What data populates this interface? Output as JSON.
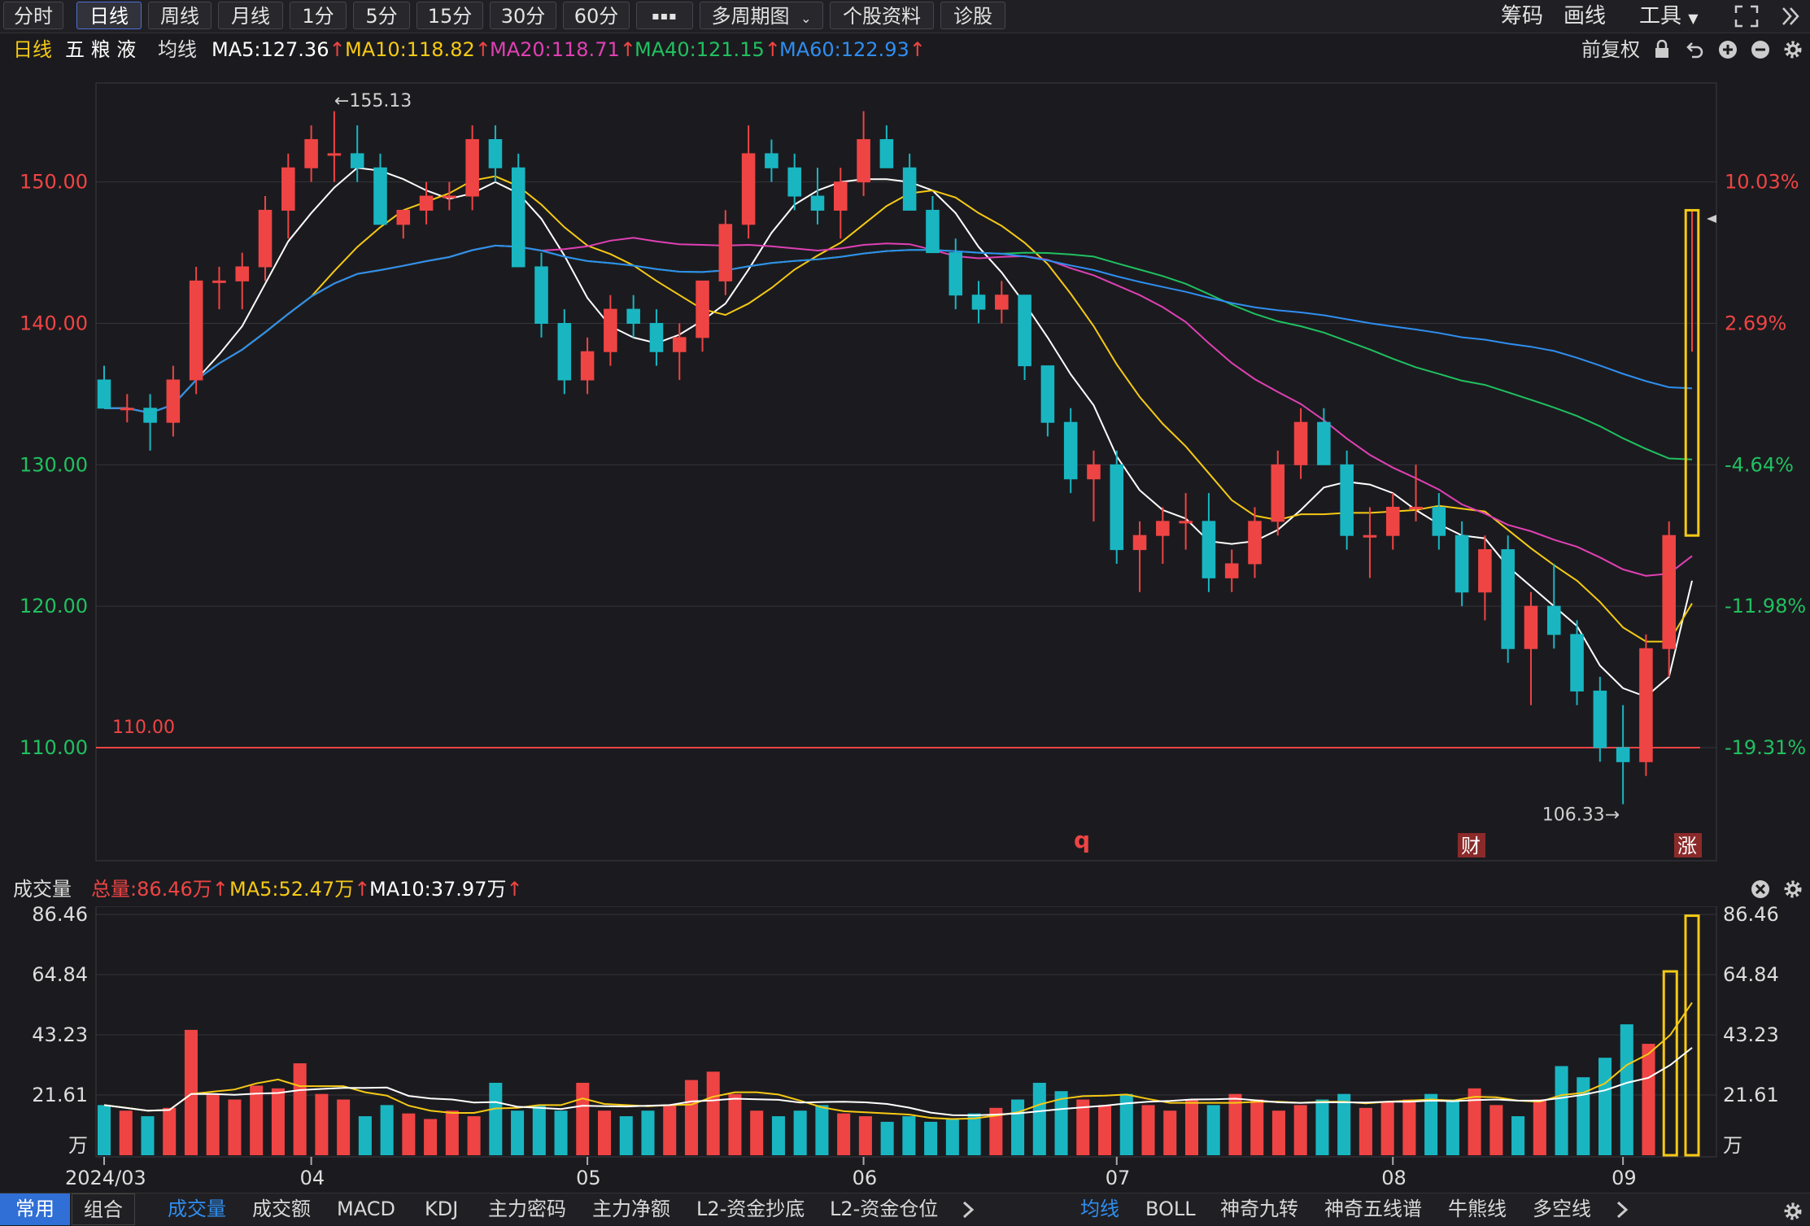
{
  "toolbar": {
    "tabs": [
      "分时",
      "日线",
      "周线",
      "月线",
      "1分",
      "5分",
      "15分",
      "30分",
      "60分"
    ],
    "more": "▪▪▪",
    "multi_period": "多周期图",
    "stock_info": "个股资料",
    "diagnose": "诊股",
    "chips": "筹码",
    "draw": "画线",
    "tools": "工具"
  },
  "info": {
    "period": "日线",
    "stock_name": "五 粮 液",
    "ma_label": "均线",
    "ma5": "MA5:127.36",
    "ma10": "MA10:118.82",
    "ma20": "MA20:118.71",
    "ma40": "MA40:121.15",
    "ma60": "MA60:122.93",
    "adjust": "前复权"
  },
  "colors": {
    "up": "#ef4444",
    "down": "#19b6c2",
    "ma5": "#ffffff",
    "ma10": "#f6c915",
    "ma20": "#e040b4",
    "ma40": "#20c060",
    "ma60": "#2f8ef0"
  },
  "chart_data": {
    "type": "candlestick",
    "y_range": [
      102,
      157
    ],
    "y_ticks": [
      "150.00",
      "140.00",
      "130.00",
      "120.00",
      "110.00"
    ],
    "y_tick_values": [
      150,
      140,
      130,
      120,
      110
    ],
    "pct_ticks": [
      "10.03%",
      "2.69%",
      "-4.64%",
      "-11.98%",
      "-19.31%"
    ],
    "high_label": "←155.13",
    "low_label": "106.33→",
    "hline_label": "110.00",
    "hline_value": 110,
    "markers": {
      "q": "q",
      "cai": "财",
      "zhang": "涨"
    },
    "x_labels": [
      "2024/03",
      "04",
      "05",
      "06",
      "07",
      "08",
      "09"
    ],
    "x_label_index": [
      0,
      9,
      21,
      33,
      44,
      56,
      66
    ],
    "ohlc": [
      [
        136,
        137,
        134,
        134
      ],
      [
        134,
        135,
        133,
        134
      ],
      [
        134,
        135,
        131,
        133
      ],
      [
        133,
        137,
        132,
        136
      ],
      [
        136,
        144,
        135,
        143
      ],
      [
        143,
        144,
        141,
        143
      ],
      [
        143,
        145,
        141,
        144
      ],
      [
        144,
        149,
        143,
        148
      ],
      [
        148,
        152,
        146,
        151
      ],
      [
        151,
        154,
        150,
        153
      ],
      [
        152,
        155,
        150,
        152
      ],
      [
        152,
        154,
        150,
        151
      ],
      [
        151,
        152,
        147,
        147
      ],
      [
        147,
        148,
        146,
        148
      ],
      [
        148,
        150,
        147,
        149
      ],
      [
        149,
        150,
        148,
        149
      ],
      [
        149,
        154,
        148,
        153
      ],
      [
        153,
        154,
        150,
        151
      ],
      [
        151,
        152,
        144,
        144
      ],
      [
        144,
        145,
        139,
        140
      ],
      [
        140,
        141,
        135,
        136
      ],
      [
        136,
        139,
        135,
        138
      ],
      [
        138,
        142,
        137,
        141
      ],
      [
        141,
        142,
        139,
        140
      ],
      [
        140,
        141,
        137,
        138
      ],
      [
        138,
        140,
        136,
        139
      ],
      [
        139,
        143,
        138,
        143
      ],
      [
        143,
        148,
        142,
        147
      ],
      [
        147,
        154,
        146,
        152
      ],
      [
        152,
        153,
        150,
        151
      ],
      [
        151,
        152,
        148,
        149
      ],
      [
        149,
        151,
        147,
        148
      ],
      [
        148,
        151,
        146,
        150
      ],
      [
        150,
        155,
        149,
        153
      ],
      [
        153,
        154,
        151,
        151
      ],
      [
        151,
        152,
        148,
        148
      ],
      [
        148,
        149,
        145,
        145
      ],
      [
        145,
        146,
        141,
        142
      ],
      [
        142,
        143,
        140,
        141
      ],
      [
        141,
        143,
        140,
        142
      ],
      [
        142,
        142,
        136,
        137
      ],
      [
        137,
        137,
        132,
        133
      ],
      [
        133,
        134,
        128,
        129
      ],
      [
        129,
        131,
        126,
        130
      ],
      [
        130,
        131,
        123,
        124
      ],
      [
        124,
        126,
        121,
        125
      ],
      [
        125,
        127,
        123,
        126
      ],
      [
        126,
        128,
        124,
        126
      ],
      [
        126,
        128,
        121,
        122
      ],
      [
        122,
        124,
        121,
        123
      ],
      [
        123,
        127,
        122,
        126
      ],
      [
        126,
        131,
        125,
        130
      ],
      [
        130,
        134,
        129,
        133
      ],
      [
        133,
        134,
        130,
        130
      ],
      [
        130,
        131,
        124,
        125
      ],
      [
        125,
        127,
        122,
        125
      ],
      [
        125,
        128,
        124,
        127
      ],
      [
        127,
        130,
        126,
        127
      ],
      [
        127,
        128,
        124,
        125
      ],
      [
        125,
        126,
        120,
        121
      ],
      [
        121,
        125,
        119,
        124
      ],
      [
        124,
        125,
        116,
        117
      ],
      [
        117,
        121,
        113,
        120
      ],
      [
        120,
        123,
        117,
        118
      ],
      [
        118,
        119,
        113,
        114
      ],
      [
        114,
        115,
        109,
        110
      ],
      [
        110,
        113,
        106,
        109
      ],
      [
        109,
        118,
        108,
        117
      ],
      [
        117,
        126,
        115,
        125
      ],
      [
        125,
        148,
        138,
        148
      ]
    ],
    "volume_max": 86.46,
    "volume_ticks": [
      "86.46",
      "64.84",
      "43.23",
      "21.61"
    ],
    "volume_tick_values": [
      86.46,
      64.84,
      43.23,
      21.61
    ],
    "volume_unit": "万",
    "volume": [
      18,
      16,
      14,
      17,
      45,
      22,
      20,
      25,
      24,
      33,
      22,
      20,
      14,
      18,
      15,
      13,
      16,
      14,
      26,
      16,
      18,
      16,
      26,
      16,
      14,
      16,
      18,
      27,
      30,
      22,
      16,
      14,
      16,
      18,
      15,
      14,
      12,
      14,
      12,
      13,
      15,
      17,
      20,
      26,
      23,
      20,
      18,
      22,
      18,
      16,
      20,
      18,
      22,
      20,
      16,
      18,
      20,
      22,
      17,
      19,
      20,
      22,
      20,
      24,
      18,
      14,
      20,
      32,
      28,
      35,
      47,
      40,
      66,
      86
    ]
  },
  "volume_panel": {
    "title": "成交量",
    "total": "总量:86.46万",
    "ma5": "MA5:52.47万",
    "ma10": "MA10:37.97万"
  },
  "bottom": {
    "left_tabs": [
      "常用",
      "组合"
    ],
    "indicators": [
      "成交量",
      "成交额",
      "MACD",
      "KDJ",
      "主力密码",
      "主力净额",
      "L2-资金抄底",
      "L2-资金仓位"
    ],
    "right_tabs": [
      "均线",
      "BOLL",
      "神奇九转",
      "神奇五线谱",
      "牛熊线",
      "多空线"
    ]
  }
}
